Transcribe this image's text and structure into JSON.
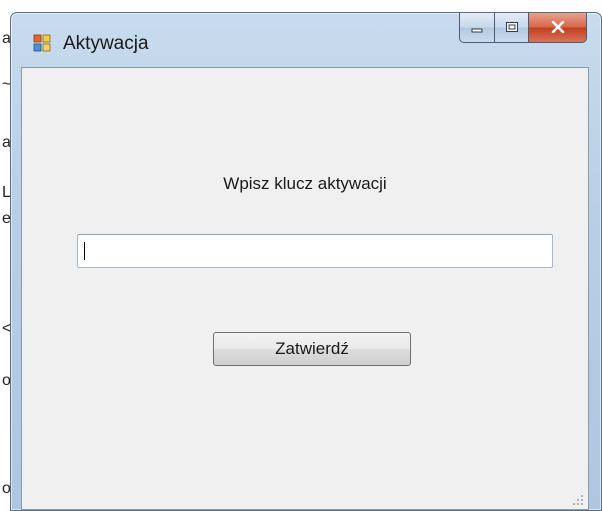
{
  "window": {
    "title": "Aktywacja",
    "icon": "winforms-app-icon",
    "caption_buttons": {
      "minimize": "minimize-icon",
      "maximize": "maximize-icon",
      "close": "close-icon"
    }
  },
  "form": {
    "prompt_label": "Wpisz klucz aktywacji",
    "key_input": {
      "value": "",
      "placeholder": ""
    },
    "submit_label": "Zatwierdź"
  },
  "background_fragments": [
    "a",
    "~",
    "a",
    "L",
    "e",
    "<",
    "o",
    "o"
  ],
  "colors": {
    "title_bar": "#b9cfe6",
    "client_area": "#f0f0f0",
    "close_button": "#c2401f"
  }
}
